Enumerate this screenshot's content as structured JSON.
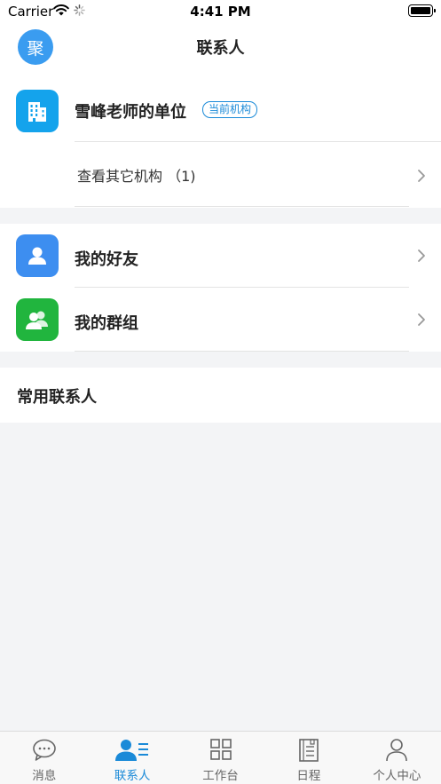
{
  "status_bar": {
    "carrier": "Carrier",
    "time": "4:41 PM"
  },
  "header": {
    "avatar_text": "聚",
    "title": "联系人"
  },
  "organization": {
    "name": "雪峰老师的单位",
    "badge": "当前机构",
    "other_label": "查看其它机构 （1)"
  },
  "social": [
    {
      "label": "我的好友",
      "icon": "friend-icon",
      "color": "#3d8ef0"
    },
    {
      "label": "我的群组",
      "icon": "group-icon",
      "color": "#21b53e"
    }
  ],
  "frequent": {
    "title": "常用联系人"
  },
  "colors": {
    "org_tile": "#14a3ec",
    "accent": "#1a8ad8"
  },
  "tabs": [
    {
      "label": "消息",
      "icon": "message-icon",
      "active": false
    },
    {
      "label": "联系人",
      "icon": "contacts-icon",
      "active": true
    },
    {
      "label": "工作台",
      "icon": "workbench-icon",
      "active": false
    },
    {
      "label": "日程",
      "icon": "schedule-icon",
      "active": false
    },
    {
      "label": "个人中心",
      "icon": "profile-icon",
      "active": false
    }
  ]
}
